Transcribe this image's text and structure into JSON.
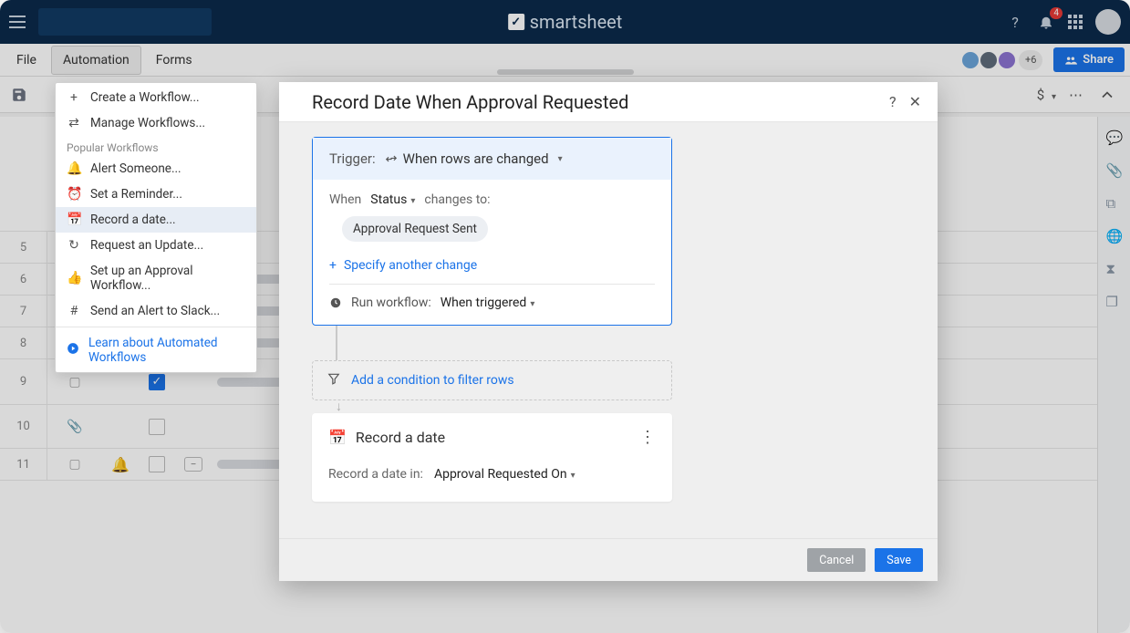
{
  "brand": "smartsheet",
  "notifications_count": "4",
  "menubar": {
    "file": "File",
    "automation": "Automation",
    "forms": "Forms"
  },
  "avatars_more": "+6",
  "share_label": "Share",
  "currency_symbol": "$",
  "dropdown": {
    "create": "Create a Workflow...",
    "manage": "Manage Workflows...",
    "section": "Popular Workflows",
    "alert": "Alert Someone...",
    "reminder": "Set a Reminder...",
    "record": "Record a date...",
    "update": "Request an Update...",
    "approval": "Set up an Approval Workflow...",
    "slack": "Send an Alert to Slack...",
    "learn": "Learn about Automated Workflows"
  },
  "grid_rows": [
    5,
    6,
    7,
    8,
    9,
    10,
    11
  ],
  "modal": {
    "title": "Record Date When Approval Requested",
    "trigger_label": "Trigger:",
    "trigger_value": "When rows are changed",
    "when_label": "When",
    "field": "Status",
    "changes_to": "changes to:",
    "chip": "Approval Request Sent",
    "specify_another": "Specify another change",
    "run_label": "Run workflow:",
    "run_value": "When triggered",
    "condition": "Add a condition to filter rows",
    "action_title": "Record a date",
    "record_in_label": "Record a date in:",
    "record_in_value": "Approval Requested On",
    "cancel": "Cancel",
    "save": "Save"
  }
}
